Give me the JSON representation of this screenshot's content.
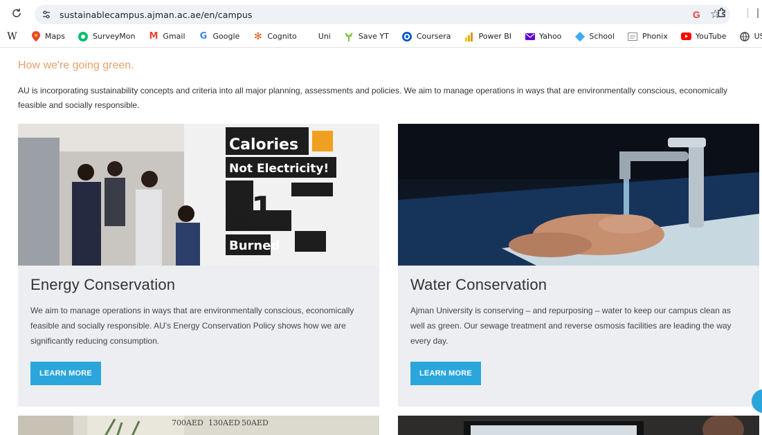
{
  "browser": {
    "url": "sustainablecampus.ajman.ac.ae/en/campus",
    "bookmarks": [
      {
        "label": "",
        "icon": "wikipedia-icon"
      },
      {
        "label": "Maps",
        "icon": "maps-icon"
      },
      {
        "label": "SurveyMon",
        "icon": "surveymonkey-icon"
      },
      {
        "label": "Gmail",
        "icon": "gmail-icon"
      },
      {
        "label": "Google",
        "icon": "google-icon"
      },
      {
        "label": "Cognito",
        "icon": "cognito-icon"
      },
      {
        "label": "Uni",
        "icon": ""
      },
      {
        "label": "Save YT",
        "icon": "save-yt-icon"
      },
      {
        "label": "Coursera",
        "icon": "coursera-icon"
      },
      {
        "label": "Power BI",
        "icon": "power-bi-icon"
      },
      {
        "label": "Yahoo",
        "icon": "yahoo-icon"
      },
      {
        "label": "School",
        "icon": "school-icon"
      },
      {
        "label": "Phonix",
        "icon": "phonix-icon"
      },
      {
        "label": "YouTube",
        "icon": "youtube-icon"
      },
      {
        "label": "USM",
        "icon": "usm-icon"
      }
    ]
  },
  "page": {
    "heading": "How we're going green.",
    "intro": "AU is incorporating sustainability concepts and criteria into all major planning, assessments and policies. We aim to manage operations in ways that are environmentally conscious, economically feasible and socially responsible.",
    "cards": [
      {
        "title": "Energy Conservation",
        "text": "We aim to manage operations in ways that are environmentally conscious, economically feasible and socially responsible. AU's Energy Conservation Policy shows how we are significantly reducing consumption.",
        "button": "LEARN MORE",
        "image_text": [
          "Calories",
          "Not Electricity!",
          "41",
          "Calories",
          "Burned"
        ]
      },
      {
        "title": "Water Conservation",
        "text": "Ajman University is conserving – and repurposing – water to keep our campus clean as well as green. Our sewage treatment and reverse osmosis facilities are leading the way every day.",
        "button": "LEARN MORE"
      }
    ],
    "partial_image_text": [
      "700AED",
      "130AED",
      "50AED"
    ]
  },
  "colors": {
    "heading": "#e8a06a",
    "button": "#2aa6dc",
    "card_bg": "#eceef1"
  }
}
